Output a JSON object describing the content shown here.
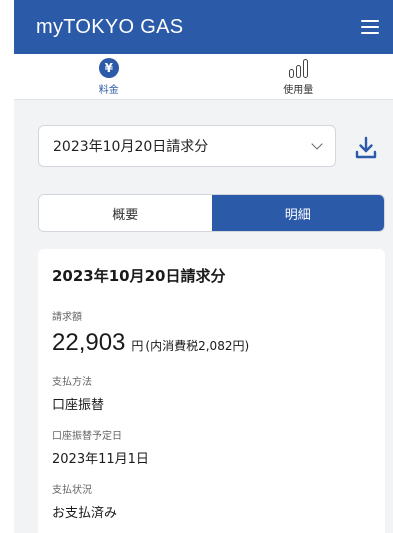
{
  "header": {
    "logo": "myTOKYO GAS",
    "menu_icon": "hamburger-menu-icon"
  },
  "nav": {
    "tabs": [
      {
        "label": "料金",
        "icon": "yen-icon",
        "active": true
      },
      {
        "label": "使用量",
        "icon": "bar-chart-icon",
        "active": false
      }
    ]
  },
  "period": {
    "selected": "2023年10月20日請求分",
    "download_icon": "download-icon"
  },
  "segment": {
    "overview": "概要",
    "detail": "明細",
    "active": "detail"
  },
  "card": {
    "title": "2023年10月20日請求分",
    "billing_label": "請求額",
    "amount": "22,903",
    "unit": "円",
    "tax": "(内消費税2,082円)",
    "payment_method_label": "支払方法",
    "payment_method": "口座振替",
    "transfer_date_label": "口座振替予定日",
    "transfer_date": "2023年11月1日",
    "status_label": "支払状況",
    "status": "お支払済み"
  },
  "colors": {
    "brand": "#2a5aa8",
    "background": "#f2f3f5"
  }
}
